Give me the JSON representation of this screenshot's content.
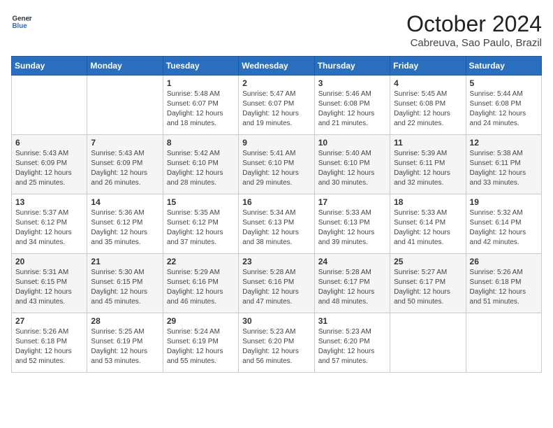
{
  "header": {
    "logo_line1": "General",
    "logo_line2": "Blue",
    "month": "October 2024",
    "location": "Cabreuva, Sao Paulo, Brazil"
  },
  "weekdays": [
    "Sunday",
    "Monday",
    "Tuesday",
    "Wednesday",
    "Thursday",
    "Friday",
    "Saturday"
  ],
  "weeks": [
    [
      {
        "day": "",
        "sunrise": "",
        "sunset": "",
        "daylight": ""
      },
      {
        "day": "",
        "sunrise": "",
        "sunset": "",
        "daylight": ""
      },
      {
        "day": "1",
        "sunrise": "Sunrise: 5:48 AM",
        "sunset": "Sunset: 6:07 PM",
        "daylight": "Daylight: 12 hours and 18 minutes."
      },
      {
        "day": "2",
        "sunrise": "Sunrise: 5:47 AM",
        "sunset": "Sunset: 6:07 PM",
        "daylight": "Daylight: 12 hours and 19 minutes."
      },
      {
        "day": "3",
        "sunrise": "Sunrise: 5:46 AM",
        "sunset": "Sunset: 6:08 PM",
        "daylight": "Daylight: 12 hours and 21 minutes."
      },
      {
        "day": "4",
        "sunrise": "Sunrise: 5:45 AM",
        "sunset": "Sunset: 6:08 PM",
        "daylight": "Daylight: 12 hours and 22 minutes."
      },
      {
        "day": "5",
        "sunrise": "Sunrise: 5:44 AM",
        "sunset": "Sunset: 6:08 PM",
        "daylight": "Daylight: 12 hours and 24 minutes."
      }
    ],
    [
      {
        "day": "6",
        "sunrise": "Sunrise: 5:43 AM",
        "sunset": "Sunset: 6:09 PM",
        "daylight": "Daylight: 12 hours and 25 minutes."
      },
      {
        "day": "7",
        "sunrise": "Sunrise: 5:43 AM",
        "sunset": "Sunset: 6:09 PM",
        "daylight": "Daylight: 12 hours and 26 minutes."
      },
      {
        "day": "8",
        "sunrise": "Sunrise: 5:42 AM",
        "sunset": "Sunset: 6:10 PM",
        "daylight": "Daylight: 12 hours and 28 minutes."
      },
      {
        "day": "9",
        "sunrise": "Sunrise: 5:41 AM",
        "sunset": "Sunset: 6:10 PM",
        "daylight": "Daylight: 12 hours and 29 minutes."
      },
      {
        "day": "10",
        "sunrise": "Sunrise: 5:40 AM",
        "sunset": "Sunset: 6:10 PM",
        "daylight": "Daylight: 12 hours and 30 minutes."
      },
      {
        "day": "11",
        "sunrise": "Sunrise: 5:39 AM",
        "sunset": "Sunset: 6:11 PM",
        "daylight": "Daylight: 12 hours and 32 minutes."
      },
      {
        "day": "12",
        "sunrise": "Sunrise: 5:38 AM",
        "sunset": "Sunset: 6:11 PM",
        "daylight": "Daylight: 12 hours and 33 minutes."
      }
    ],
    [
      {
        "day": "13",
        "sunrise": "Sunrise: 5:37 AM",
        "sunset": "Sunset: 6:12 PM",
        "daylight": "Daylight: 12 hours and 34 minutes."
      },
      {
        "day": "14",
        "sunrise": "Sunrise: 5:36 AM",
        "sunset": "Sunset: 6:12 PM",
        "daylight": "Daylight: 12 hours and 35 minutes."
      },
      {
        "day": "15",
        "sunrise": "Sunrise: 5:35 AM",
        "sunset": "Sunset: 6:12 PM",
        "daylight": "Daylight: 12 hours and 37 minutes."
      },
      {
        "day": "16",
        "sunrise": "Sunrise: 5:34 AM",
        "sunset": "Sunset: 6:13 PM",
        "daylight": "Daylight: 12 hours and 38 minutes."
      },
      {
        "day": "17",
        "sunrise": "Sunrise: 5:33 AM",
        "sunset": "Sunset: 6:13 PM",
        "daylight": "Daylight: 12 hours and 39 minutes."
      },
      {
        "day": "18",
        "sunrise": "Sunrise: 5:33 AM",
        "sunset": "Sunset: 6:14 PM",
        "daylight": "Daylight: 12 hours and 41 minutes."
      },
      {
        "day": "19",
        "sunrise": "Sunrise: 5:32 AM",
        "sunset": "Sunset: 6:14 PM",
        "daylight": "Daylight: 12 hours and 42 minutes."
      }
    ],
    [
      {
        "day": "20",
        "sunrise": "Sunrise: 5:31 AM",
        "sunset": "Sunset: 6:15 PM",
        "daylight": "Daylight: 12 hours and 43 minutes."
      },
      {
        "day": "21",
        "sunrise": "Sunrise: 5:30 AM",
        "sunset": "Sunset: 6:15 PM",
        "daylight": "Daylight: 12 hours and 45 minutes."
      },
      {
        "day": "22",
        "sunrise": "Sunrise: 5:29 AM",
        "sunset": "Sunset: 6:16 PM",
        "daylight": "Daylight: 12 hours and 46 minutes."
      },
      {
        "day": "23",
        "sunrise": "Sunrise: 5:28 AM",
        "sunset": "Sunset: 6:16 PM",
        "daylight": "Daylight: 12 hours and 47 minutes."
      },
      {
        "day": "24",
        "sunrise": "Sunrise: 5:28 AM",
        "sunset": "Sunset: 6:17 PM",
        "daylight": "Daylight: 12 hours and 48 minutes."
      },
      {
        "day": "25",
        "sunrise": "Sunrise: 5:27 AM",
        "sunset": "Sunset: 6:17 PM",
        "daylight": "Daylight: 12 hours and 50 minutes."
      },
      {
        "day": "26",
        "sunrise": "Sunrise: 5:26 AM",
        "sunset": "Sunset: 6:18 PM",
        "daylight": "Daylight: 12 hours and 51 minutes."
      }
    ],
    [
      {
        "day": "27",
        "sunrise": "Sunrise: 5:26 AM",
        "sunset": "Sunset: 6:18 PM",
        "daylight": "Daylight: 12 hours and 52 minutes."
      },
      {
        "day": "28",
        "sunrise": "Sunrise: 5:25 AM",
        "sunset": "Sunset: 6:19 PM",
        "daylight": "Daylight: 12 hours and 53 minutes."
      },
      {
        "day": "29",
        "sunrise": "Sunrise: 5:24 AM",
        "sunset": "Sunset: 6:19 PM",
        "daylight": "Daylight: 12 hours and 55 minutes."
      },
      {
        "day": "30",
        "sunrise": "Sunrise: 5:23 AM",
        "sunset": "Sunset: 6:20 PM",
        "daylight": "Daylight: 12 hours and 56 minutes."
      },
      {
        "day": "31",
        "sunrise": "Sunrise: 5:23 AM",
        "sunset": "Sunset: 6:20 PM",
        "daylight": "Daylight: 12 hours and 57 minutes."
      },
      {
        "day": "",
        "sunrise": "",
        "sunset": "",
        "daylight": ""
      },
      {
        "day": "",
        "sunrise": "",
        "sunset": "",
        "daylight": ""
      }
    ]
  ]
}
